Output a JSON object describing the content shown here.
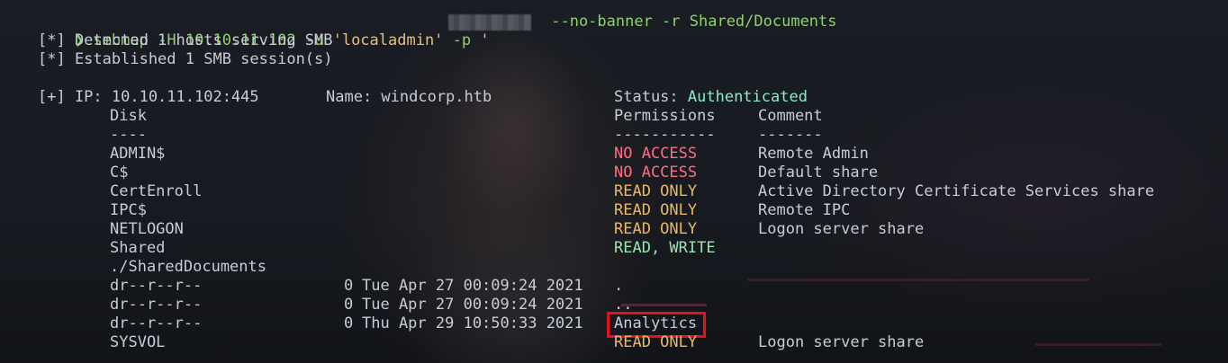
{
  "command": {
    "prompt_symbol": "❯",
    "program": "smbmap",
    "part_host": "-H 10.10.11.102 -u ",
    "user": "'localadmin'",
    "part_p": " -p ",
    "pass_prefix": "'",
    "part_rest": " --no-banner -r Shared/Documents"
  },
  "messages": [
    "[*] Detected 1 hosts serving SMB",
    "[*] Established 1 SMB session(s)"
  ],
  "host": {
    "ip_label": "[+] IP: 10.10.11.102:445",
    "name_label": "Name: windcorp.htb",
    "status_label": "Status: ",
    "status_value": "Authenticated"
  },
  "table": {
    "headers": {
      "disk": "Disk",
      "permissions": "Permissions",
      "comment": "Comment"
    },
    "separators": {
      "disk": "----",
      "permissions": "-----------",
      "comment": "-------"
    },
    "shares": [
      {
        "name": "ADMIN$",
        "perm": "NO ACCESS",
        "comment": "Remote Admin"
      },
      {
        "name": "C$",
        "perm": "NO ACCESS",
        "comment": "Default share"
      },
      {
        "name": "CertEnroll",
        "perm": "READ ONLY",
        "comment": "Active Directory Certificate Services share"
      },
      {
        "name": "IPC$",
        "perm": "READ ONLY",
        "comment": "Remote IPC"
      },
      {
        "name": "NETLOGON",
        "perm": "READ ONLY",
        "comment": "Logon server share"
      },
      {
        "name": "Shared",
        "perm": "READ, WRITE",
        "comment": ""
      }
    ],
    "path": "./SharedDocuments",
    "entries": [
      {
        "mode": "dr--r--r--",
        "size": "0",
        "date": "Tue Apr 27 00:09:24 2021",
        "name": "."
      },
      {
        "mode": "dr--r--r--",
        "size": "0",
        "date": "Tue Apr 27 00:09:24 2021",
        "name": ".."
      },
      {
        "mode": "dr--r--r--",
        "size": "0",
        "date": "Thu Apr 29 10:50:33 2021",
        "name": "Analytics"
      }
    ],
    "last_share": {
      "name": "SYSVOL",
      "perm": "READ ONLY",
      "comment": "Logon server share"
    }
  }
}
